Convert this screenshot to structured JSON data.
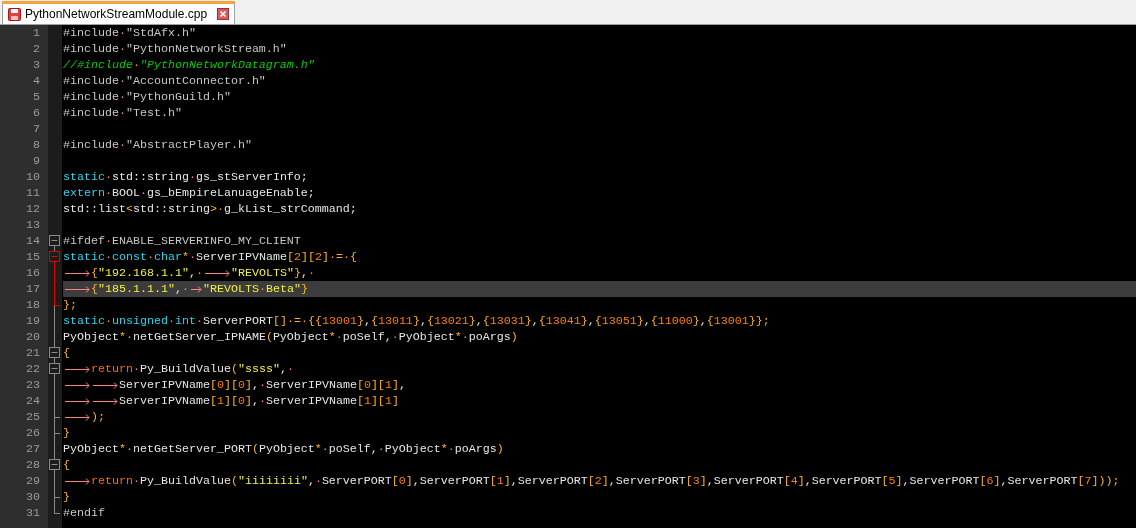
{
  "tab": {
    "title": "PythonNetworkStreamModule.cpp",
    "selected": true,
    "unsaved": true
  },
  "lines": [
    {
      "number": "1",
      "current": false,
      "tokens": [
        {
          "kind": "pre",
          "text": "#include"
        },
        {
          "kind": "space",
          "text": "·"
        },
        {
          "kind": "pre",
          "text": "\"StdAfx.h\""
        }
      ]
    },
    {
      "number": "2",
      "current": false,
      "tokens": [
        {
          "kind": "pre",
          "text": "#include"
        },
        {
          "kind": "space",
          "text": "·"
        },
        {
          "kind": "pre",
          "text": "\"PythonNetworkStream.h\""
        }
      ]
    },
    {
      "number": "3",
      "current": false,
      "tokens": [
        {
          "kind": "comment",
          "text": "//#include"
        },
        {
          "kind": "space",
          "text": "·"
        },
        {
          "kind": "comment",
          "text": "\"PythonNetworkDatagram.h\""
        }
      ]
    },
    {
      "number": "4",
      "current": false,
      "tokens": [
        {
          "kind": "pre",
          "text": "#include"
        },
        {
          "kind": "space",
          "text": "·"
        },
        {
          "kind": "pre",
          "text": "\"AccountConnector.h\""
        }
      ]
    },
    {
      "number": "5",
      "current": false,
      "tokens": [
        {
          "kind": "pre",
          "text": "#include"
        },
        {
          "kind": "space",
          "text": "·"
        },
        {
          "kind": "pre",
          "text": "\"PythonGuild.h\""
        }
      ]
    },
    {
      "number": "6",
      "current": false,
      "tokens": [
        {
          "kind": "pre",
          "text": "#include"
        },
        {
          "kind": "space",
          "text": "·"
        },
        {
          "kind": "pre",
          "text": "\"Test.h\""
        }
      ]
    },
    {
      "number": "7",
      "current": false
    },
    {
      "number": "8",
      "current": false,
      "tokens": [
        {
          "kind": "pre",
          "text": "#include"
        },
        {
          "kind": "space",
          "text": "·"
        },
        {
          "kind": "pre",
          "text": "\"AbstractPlayer.h\""
        }
      ]
    },
    {
      "number": "9",
      "current": false
    },
    {
      "number": "10",
      "current": false,
      "tokens": [
        {
          "kind": "keyword",
          "text": "static"
        },
        {
          "kind": "space",
          "text": "·"
        },
        {
          "kind": "ident",
          "text": "std::string"
        },
        {
          "kind": "space",
          "text": "·"
        },
        {
          "kind": "ident",
          "text": "gs_stServerInfo;"
        }
      ]
    },
    {
      "number": "11",
      "current": false,
      "tokens": [
        {
          "kind": "keyword",
          "text": "extern"
        },
        {
          "kind": "space",
          "text": "·"
        },
        {
          "kind": "ident",
          "text": "BOOL"
        },
        {
          "kind": "space",
          "text": "·"
        },
        {
          "kind": "ident",
          "text": "gs_bEmpireLanuageEnable;"
        }
      ]
    },
    {
      "number": "12",
      "current": false,
      "tokens": [
        {
          "kind": "ident",
          "text": "std::list"
        },
        {
          "kind": "op",
          "text": "<"
        },
        {
          "kind": "ident",
          "text": "std::string"
        },
        {
          "kind": "op",
          "text": ">"
        },
        {
          "kind": "space",
          "text": "·"
        },
        {
          "kind": "ident",
          "text": "g_kList_strCommand;"
        }
      ]
    },
    {
      "number": "13",
      "current": false
    },
    {
      "number": "14",
      "current": false,
      "fold_start": true,
      "highlighted": false,
      "tokens": [
        {
          "kind": "pre",
          "text": "#ifdef"
        },
        {
          "kind": "space",
          "text": "·"
        },
        {
          "kind": "pre",
          "text": "ENABLE_SERVERINFO_MY_CLIENT"
        }
      ]
    },
    {
      "number": "15",
      "current": false,
      "fold_start": true,
      "highlighted": true,
      "tokens": [
        {
          "kind": "keyword",
          "text": "static"
        },
        {
          "kind": "space",
          "text": "·"
        },
        {
          "kind": "keyword",
          "text": "const"
        },
        {
          "kind": "space",
          "text": "·"
        },
        {
          "kind": "keyword",
          "text": "char"
        },
        {
          "kind": "op",
          "text": "*"
        },
        {
          "kind": "space",
          "text": "·"
        },
        {
          "kind": "ident",
          "text": "ServerIPVName"
        },
        {
          "kind": "op",
          "text": "["
        },
        {
          "kind": "num",
          "text": "2"
        },
        {
          "kind": "op",
          "text": "]["
        },
        {
          "kind": "num",
          "text": "2"
        },
        {
          "kind": "op",
          "text": "]"
        },
        {
          "kind": "space",
          "text": "·"
        },
        {
          "kind": "op",
          "text": "="
        },
        {
          "kind": "space",
          "text": "·"
        },
        {
          "kind": "op",
          "text": "{"
        }
      ]
    },
    {
      "number": "16",
      "current": false,
      "tokens": [
        {
          "kind": "tab"
        },
        {
          "kind": "op",
          "text": "{"
        },
        {
          "kind": "str",
          "text": "\"192.168.1.1\""
        },
        {
          "kind": "ident",
          "text": ","
        },
        {
          "kind": "space",
          "text": "·"
        },
        {
          "kind": "tab"
        },
        {
          "kind": "str",
          "text": "\"REVOLTS\""
        },
        {
          "kind": "op",
          "text": "}"
        },
        {
          "kind": "ident",
          "text": ","
        },
        {
          "kind": "space",
          "text": "·"
        }
      ]
    },
    {
      "number": "17",
      "current": true,
      "tokens": [
        {
          "kind": "tab"
        },
        {
          "kind": "op",
          "text": "{"
        },
        {
          "kind": "str",
          "text": "\"185.1.1.1\""
        },
        {
          "kind": "ident",
          "text": ","
        },
        {
          "kind": "space",
          "text": "·"
        },
        {
          "kind": "tab"
        },
        {
          "kind": "str",
          "text": "\"REVOLTS"
        },
        {
          "kind": "space",
          "text": "·"
        },
        {
          "kind": "str",
          "text": "Beta\""
        },
        {
          "kind": "op",
          "text": "}"
        }
      ]
    },
    {
      "number": "18",
      "current": false,
      "fold_end": true,
      "tokens": [
        {
          "kind": "op",
          "text": "};"
        }
      ]
    },
    {
      "number": "19",
      "current": false,
      "tokens": [
        {
          "kind": "keyword",
          "text": "static"
        },
        {
          "kind": "space",
          "text": "·"
        },
        {
          "kind": "keyword",
          "text": "unsigned"
        },
        {
          "kind": "space",
          "text": "·"
        },
        {
          "kind": "keyword",
          "text": "int"
        },
        {
          "kind": "space",
          "text": "·"
        },
        {
          "kind": "ident",
          "text": "ServerPORT"
        },
        {
          "kind": "op",
          "text": "[]"
        },
        {
          "kind": "space",
          "text": "·"
        },
        {
          "kind": "op",
          "text": "="
        },
        {
          "kind": "space",
          "text": "·"
        },
        {
          "kind": "op",
          "text": "{{"
        },
        {
          "kind": "num",
          "text": "13001"
        },
        {
          "kind": "op",
          "text": "}"
        },
        {
          "kind": "ident",
          "text": ","
        },
        {
          "kind": "op",
          "text": "{"
        },
        {
          "kind": "num",
          "text": "13011"
        },
        {
          "kind": "op",
          "text": "}"
        },
        {
          "kind": "ident",
          "text": ","
        },
        {
          "kind": "op",
          "text": "{"
        },
        {
          "kind": "num",
          "text": "13021"
        },
        {
          "kind": "op",
          "text": "}"
        },
        {
          "kind": "ident",
          "text": ","
        },
        {
          "kind": "op",
          "text": "{"
        },
        {
          "kind": "num",
          "text": "13031"
        },
        {
          "kind": "op",
          "text": "}"
        },
        {
          "kind": "ident",
          "text": ","
        },
        {
          "kind": "op",
          "text": "{"
        },
        {
          "kind": "num",
          "text": "13041"
        },
        {
          "kind": "op",
          "text": "}"
        },
        {
          "kind": "ident",
          "text": ","
        },
        {
          "kind": "op",
          "text": "{"
        },
        {
          "kind": "num",
          "text": "13051"
        },
        {
          "kind": "op",
          "text": "}"
        },
        {
          "kind": "ident",
          "text": ","
        },
        {
          "kind": "op",
          "text": "{"
        },
        {
          "kind": "num",
          "text": "11000"
        },
        {
          "kind": "op",
          "text": "}"
        },
        {
          "kind": "ident",
          "text": ","
        },
        {
          "kind": "op",
          "text": "{"
        },
        {
          "kind": "num",
          "text": "13001"
        },
        {
          "kind": "op",
          "text": "}};"
        }
      ]
    },
    {
      "number": "20",
      "current": false,
      "tokens": [
        {
          "kind": "ident",
          "text": "PyObject"
        },
        {
          "kind": "op",
          "text": "*"
        },
        {
          "kind": "space",
          "text": "·"
        },
        {
          "kind": "ident",
          "text": "netGetServer_IPNAME"
        },
        {
          "kind": "op",
          "text": "("
        },
        {
          "kind": "ident",
          "text": "PyObject"
        },
        {
          "kind": "op",
          "text": "*"
        },
        {
          "kind": "space",
          "text": "·"
        },
        {
          "kind": "ident",
          "text": "poSelf,"
        },
        {
          "kind": "space",
          "text": "·"
        },
        {
          "kind": "ident",
          "text": "PyObject"
        },
        {
          "kind": "op",
          "text": "*"
        },
        {
          "kind": "space",
          "text": "·"
        },
        {
          "kind": "ident",
          "text": "poArgs"
        },
        {
          "kind": "op",
          "text": ")"
        }
      ]
    },
    {
      "number": "21",
      "current": false,
      "fold_start": true,
      "highlighted": false,
      "tokens": [
        {
          "kind": "op",
          "text": "{"
        }
      ]
    },
    {
      "number": "22",
      "current": false,
      "fold_start": true,
      "highlighted": false,
      "tokens": [
        {
          "kind": "tab"
        },
        {
          "kind": "return",
          "text": "return"
        },
        {
          "kind": "space",
          "text": "·"
        },
        {
          "kind": "ident",
          "text": "Py_BuildValue"
        },
        {
          "kind": "op",
          "text": "("
        },
        {
          "kind": "str",
          "text": "\"ssss\""
        },
        {
          "kind": "ident",
          "text": ","
        },
        {
          "kind": "space",
          "text": "·"
        }
      ]
    },
    {
      "number": "23",
      "current": false,
      "tokens": [
        {
          "kind": "tab"
        },
        {
          "kind": "tab"
        },
        {
          "kind": "ident",
          "text": "ServerIPVName"
        },
        {
          "kind": "op",
          "text": "["
        },
        {
          "kind": "num",
          "text": "0"
        },
        {
          "kind": "op",
          "text": "]["
        },
        {
          "kind": "num",
          "text": "0"
        },
        {
          "kind": "op",
          "text": "]"
        },
        {
          "kind": "ident",
          "text": ","
        },
        {
          "kind": "space",
          "text": "·"
        },
        {
          "kind": "ident",
          "text": "ServerIPVName"
        },
        {
          "kind": "op",
          "text": "["
        },
        {
          "kind": "num",
          "text": "0"
        },
        {
          "kind": "op",
          "text": "]["
        },
        {
          "kind": "num",
          "text": "1"
        },
        {
          "kind": "op",
          "text": "]"
        },
        {
          "kind": "ident",
          "text": ","
        }
      ]
    },
    {
      "number": "24",
      "current": false,
      "tokens": [
        {
          "kind": "tab"
        },
        {
          "kind": "tab"
        },
        {
          "kind": "ident",
          "text": "ServerIPVName"
        },
        {
          "kind": "op",
          "text": "["
        },
        {
          "kind": "num",
          "text": "1"
        },
        {
          "kind": "op",
          "text": "]["
        },
        {
          "kind": "num",
          "text": "0"
        },
        {
          "kind": "op",
          "text": "]"
        },
        {
          "kind": "ident",
          "text": ","
        },
        {
          "kind": "space",
          "text": "·"
        },
        {
          "kind": "ident",
          "text": "ServerIPVName"
        },
        {
          "kind": "op",
          "text": "["
        },
        {
          "kind": "num",
          "text": "1"
        },
        {
          "kind": "op",
          "text": "]["
        },
        {
          "kind": "num",
          "text": "1"
        },
        {
          "kind": "op",
          "text": "]"
        }
      ]
    },
    {
      "number": "25",
      "current": false,
      "fold_end": true,
      "tokens": [
        {
          "kind": "tab"
        },
        {
          "kind": "op",
          "text": ");"
        }
      ]
    },
    {
      "number": "26",
      "current": false,
      "fold_end": true,
      "tokens": [
        {
          "kind": "op",
          "text": "}"
        }
      ]
    },
    {
      "number": "27",
      "current": false,
      "tokens": [
        {
          "kind": "ident",
          "text": "PyObject"
        },
        {
          "kind": "op",
          "text": "*"
        },
        {
          "kind": "space",
          "text": "·"
        },
        {
          "kind": "ident",
          "text": "netGetServer_PORT"
        },
        {
          "kind": "op",
          "text": "("
        },
        {
          "kind": "ident",
          "text": "PyObject"
        },
        {
          "kind": "op",
          "text": "*"
        },
        {
          "kind": "space",
          "text": "·"
        },
        {
          "kind": "ident",
          "text": "poSelf,"
        },
        {
          "kind": "space",
          "text": "·"
        },
        {
          "kind": "ident",
          "text": "PyObject"
        },
        {
          "kind": "op",
          "text": "*"
        },
        {
          "kind": "space",
          "text": "·"
        },
        {
          "kind": "ident",
          "text": "poArgs"
        },
        {
          "kind": "op",
          "text": ")"
        }
      ]
    },
    {
      "number": "28",
      "current": false,
      "fold_start": true,
      "highlighted": false,
      "tokens": [
        {
          "kind": "op",
          "text": "{"
        }
      ]
    },
    {
      "number": "29",
      "current": false,
      "tokens": [
        {
          "kind": "tab"
        },
        {
          "kind": "return",
          "text": "return"
        },
        {
          "kind": "space",
          "text": "·"
        },
        {
          "kind": "ident",
          "text": "Py_BuildValue"
        },
        {
          "kind": "op",
          "text": "("
        },
        {
          "kind": "str",
          "text": "\"iiiiiiii\""
        },
        {
          "kind": "ident",
          "text": ","
        },
        {
          "kind": "space",
          "text": "·"
        },
        {
          "kind": "ident",
          "text": "ServerPORT"
        },
        {
          "kind": "op",
          "text": "["
        },
        {
          "kind": "num",
          "text": "0"
        },
        {
          "kind": "op",
          "text": "]"
        },
        {
          "kind": "ident",
          "text": ",ServerPORT"
        },
        {
          "kind": "op",
          "text": "["
        },
        {
          "kind": "num",
          "text": "1"
        },
        {
          "kind": "op",
          "text": "]"
        },
        {
          "kind": "ident",
          "text": ",ServerPORT"
        },
        {
          "kind": "op",
          "text": "["
        },
        {
          "kind": "num",
          "text": "2"
        },
        {
          "kind": "op",
          "text": "]"
        },
        {
          "kind": "ident",
          "text": ",ServerPORT"
        },
        {
          "kind": "op",
          "text": "["
        },
        {
          "kind": "num",
          "text": "3"
        },
        {
          "kind": "op",
          "text": "]"
        },
        {
          "kind": "ident",
          "text": ",ServerPORT"
        },
        {
          "kind": "op",
          "text": "["
        },
        {
          "kind": "num",
          "text": "4"
        },
        {
          "kind": "op",
          "text": "]"
        },
        {
          "kind": "ident",
          "text": ",ServerPORT"
        },
        {
          "kind": "op",
          "text": "["
        },
        {
          "kind": "num",
          "text": "5"
        },
        {
          "kind": "op",
          "text": "]"
        },
        {
          "kind": "ident",
          "text": ",ServerPORT"
        },
        {
          "kind": "op",
          "text": "["
        },
        {
          "kind": "num",
          "text": "6"
        },
        {
          "kind": "op",
          "text": "]"
        },
        {
          "kind": "ident",
          "text": ",ServerPORT"
        },
        {
          "kind": "op",
          "text": "["
        },
        {
          "kind": "num",
          "text": "7"
        },
        {
          "kind": "op",
          "text": "]));"
        }
      ]
    },
    {
      "number": "30",
      "current": false,
      "fold_end": true,
      "tokens": [
        {
          "kind": "op",
          "text": "}"
        }
      ]
    },
    {
      "number": "31",
      "current": false,
      "fold_end": true,
      "tokens": [
        {
          "kind": "pre",
          "text": "#endif"
        }
      ]
    }
  ]
}
